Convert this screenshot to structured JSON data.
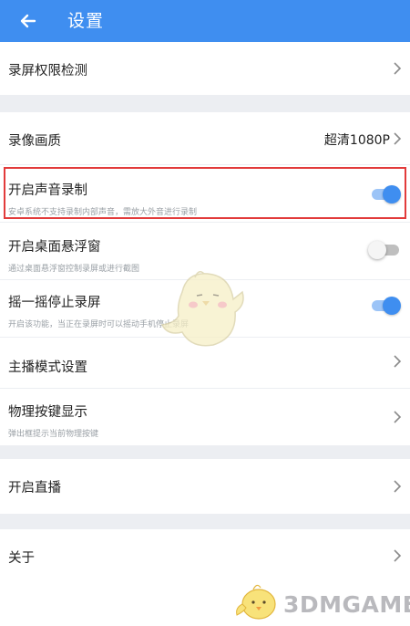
{
  "header": {
    "title": "设置",
    "back_icon": "arrow-left-icon",
    "background": "#3f8ef0"
  },
  "sections": {
    "permission": {
      "label": "录屏权限检测"
    },
    "quality": {
      "label": "录像画质",
      "value": "超清1080P"
    },
    "audio": {
      "label": "开启声音录制",
      "sub": "安卓系统不支持录制内部声音，需放大外音进行录制",
      "toggle": "on"
    },
    "floating": {
      "label": "开启桌面悬浮窗",
      "sub": "通过桌面悬浮窗控制录屏或进行截图",
      "toggle": "off"
    },
    "shake": {
      "label": "摇一摇停止录屏",
      "sub": "开启该功能，当正在录屏时可以摇动手机停止录屏",
      "toggle": "on"
    },
    "anchor": {
      "label": "主播模式设置"
    },
    "keys": {
      "label": "物理按键显示",
      "sub": "弹出框提示当前物理按键"
    },
    "live": {
      "label": "开启直播"
    },
    "about": {
      "label": "关于"
    }
  },
  "watermark": {
    "text": "3DMGAME",
    "mascot": "chick-mascot-icon"
  },
  "colors": {
    "accent": "#3f8ef0",
    "divider": "#eceef2",
    "highlight": "#e23b3b"
  }
}
